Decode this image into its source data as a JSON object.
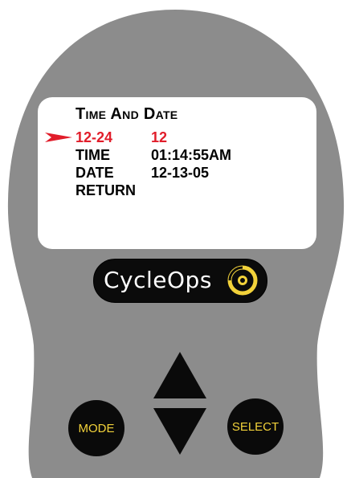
{
  "screen": {
    "title": "Time And Date",
    "rows": [
      {
        "label": "12-24",
        "value": "12",
        "selected": true
      },
      {
        "label": "TIME",
        "value": "01:14:55AM",
        "selected": false
      },
      {
        "label": "DATE",
        "value": "12-13-05",
        "selected": false
      },
      {
        "label": "RETURN",
        "value": "",
        "selected": false
      }
    ],
    "pointer_icon": "red-arrow-pointer"
  },
  "logo": {
    "text": "CycleOps"
  },
  "buttons": {
    "mode_label": "MODE",
    "select_label": "SELECT"
  },
  "colors": {
    "body": "#8c8c8c",
    "screen": "#ffffff",
    "highlight": "#e11d2a",
    "button_text": "#f2d23a",
    "logo_ring": "#f2d23a"
  }
}
